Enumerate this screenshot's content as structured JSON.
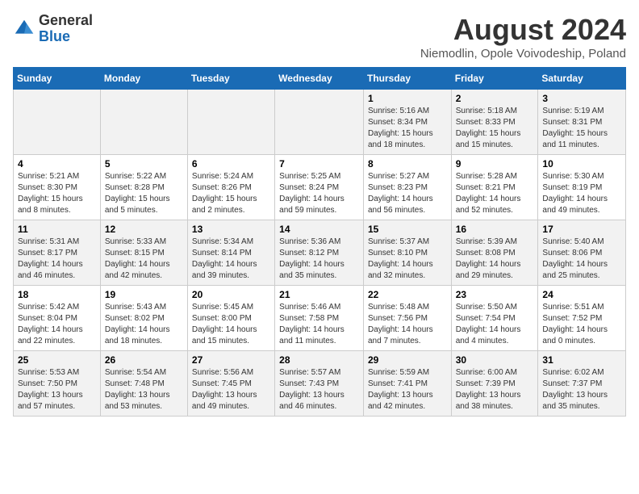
{
  "logo": {
    "general": "General",
    "blue": "Blue"
  },
  "title": "August 2024",
  "location": "Niemodlin, Opole Voivodeship, Poland",
  "headers": [
    "Sunday",
    "Monday",
    "Tuesday",
    "Wednesday",
    "Thursday",
    "Friday",
    "Saturday"
  ],
  "weeks": [
    [
      {
        "day": "",
        "info": ""
      },
      {
        "day": "",
        "info": ""
      },
      {
        "day": "",
        "info": ""
      },
      {
        "day": "",
        "info": ""
      },
      {
        "day": "1",
        "info": "Sunrise: 5:16 AM\nSunset: 8:34 PM\nDaylight: 15 hours\nand 18 minutes."
      },
      {
        "day": "2",
        "info": "Sunrise: 5:18 AM\nSunset: 8:33 PM\nDaylight: 15 hours\nand 15 minutes."
      },
      {
        "day": "3",
        "info": "Sunrise: 5:19 AM\nSunset: 8:31 PM\nDaylight: 15 hours\nand 11 minutes."
      }
    ],
    [
      {
        "day": "4",
        "info": "Sunrise: 5:21 AM\nSunset: 8:30 PM\nDaylight: 15 hours\nand 8 minutes."
      },
      {
        "day": "5",
        "info": "Sunrise: 5:22 AM\nSunset: 8:28 PM\nDaylight: 15 hours\nand 5 minutes."
      },
      {
        "day": "6",
        "info": "Sunrise: 5:24 AM\nSunset: 8:26 PM\nDaylight: 15 hours\nand 2 minutes."
      },
      {
        "day": "7",
        "info": "Sunrise: 5:25 AM\nSunset: 8:24 PM\nDaylight: 14 hours\nand 59 minutes."
      },
      {
        "day": "8",
        "info": "Sunrise: 5:27 AM\nSunset: 8:23 PM\nDaylight: 14 hours\nand 56 minutes."
      },
      {
        "day": "9",
        "info": "Sunrise: 5:28 AM\nSunset: 8:21 PM\nDaylight: 14 hours\nand 52 minutes."
      },
      {
        "day": "10",
        "info": "Sunrise: 5:30 AM\nSunset: 8:19 PM\nDaylight: 14 hours\nand 49 minutes."
      }
    ],
    [
      {
        "day": "11",
        "info": "Sunrise: 5:31 AM\nSunset: 8:17 PM\nDaylight: 14 hours\nand 46 minutes."
      },
      {
        "day": "12",
        "info": "Sunrise: 5:33 AM\nSunset: 8:15 PM\nDaylight: 14 hours\nand 42 minutes."
      },
      {
        "day": "13",
        "info": "Sunrise: 5:34 AM\nSunset: 8:14 PM\nDaylight: 14 hours\nand 39 minutes."
      },
      {
        "day": "14",
        "info": "Sunrise: 5:36 AM\nSunset: 8:12 PM\nDaylight: 14 hours\nand 35 minutes."
      },
      {
        "day": "15",
        "info": "Sunrise: 5:37 AM\nSunset: 8:10 PM\nDaylight: 14 hours\nand 32 minutes."
      },
      {
        "day": "16",
        "info": "Sunrise: 5:39 AM\nSunset: 8:08 PM\nDaylight: 14 hours\nand 29 minutes."
      },
      {
        "day": "17",
        "info": "Sunrise: 5:40 AM\nSunset: 8:06 PM\nDaylight: 14 hours\nand 25 minutes."
      }
    ],
    [
      {
        "day": "18",
        "info": "Sunrise: 5:42 AM\nSunset: 8:04 PM\nDaylight: 14 hours\nand 22 minutes."
      },
      {
        "day": "19",
        "info": "Sunrise: 5:43 AM\nSunset: 8:02 PM\nDaylight: 14 hours\nand 18 minutes."
      },
      {
        "day": "20",
        "info": "Sunrise: 5:45 AM\nSunset: 8:00 PM\nDaylight: 14 hours\nand 15 minutes."
      },
      {
        "day": "21",
        "info": "Sunrise: 5:46 AM\nSunset: 7:58 PM\nDaylight: 14 hours\nand 11 minutes."
      },
      {
        "day": "22",
        "info": "Sunrise: 5:48 AM\nSunset: 7:56 PM\nDaylight: 14 hours\nand 7 minutes."
      },
      {
        "day": "23",
        "info": "Sunrise: 5:50 AM\nSunset: 7:54 PM\nDaylight: 14 hours\nand 4 minutes."
      },
      {
        "day": "24",
        "info": "Sunrise: 5:51 AM\nSunset: 7:52 PM\nDaylight: 14 hours\nand 0 minutes."
      }
    ],
    [
      {
        "day": "25",
        "info": "Sunrise: 5:53 AM\nSunset: 7:50 PM\nDaylight: 13 hours\nand 57 minutes."
      },
      {
        "day": "26",
        "info": "Sunrise: 5:54 AM\nSunset: 7:48 PM\nDaylight: 13 hours\nand 53 minutes."
      },
      {
        "day": "27",
        "info": "Sunrise: 5:56 AM\nSunset: 7:45 PM\nDaylight: 13 hours\nand 49 minutes."
      },
      {
        "day": "28",
        "info": "Sunrise: 5:57 AM\nSunset: 7:43 PM\nDaylight: 13 hours\nand 46 minutes."
      },
      {
        "day": "29",
        "info": "Sunrise: 5:59 AM\nSunset: 7:41 PM\nDaylight: 13 hours\nand 42 minutes."
      },
      {
        "day": "30",
        "info": "Sunrise: 6:00 AM\nSunset: 7:39 PM\nDaylight: 13 hours\nand 38 minutes."
      },
      {
        "day": "31",
        "info": "Sunrise: 6:02 AM\nSunset: 7:37 PM\nDaylight: 13 hours\nand 35 minutes."
      }
    ]
  ]
}
